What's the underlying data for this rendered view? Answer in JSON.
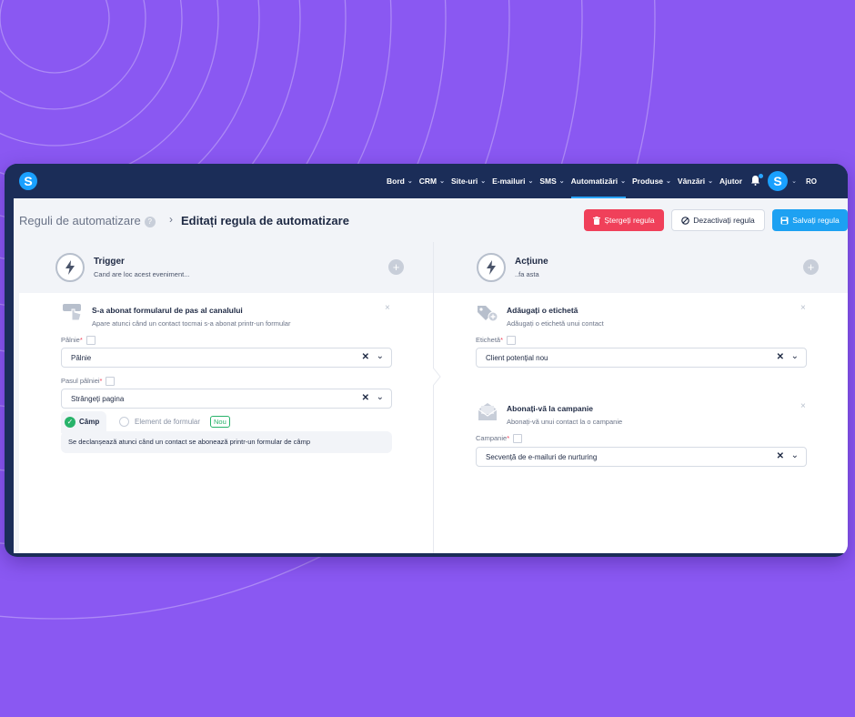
{
  "nav": {
    "items": [
      {
        "label": "Bord",
        "chevron": true,
        "active": false
      },
      {
        "label": "CRM",
        "chevron": true,
        "active": false
      },
      {
        "label": "Site-uri",
        "chevron": true,
        "active": false
      },
      {
        "label": "E-mailuri",
        "chevron": true,
        "active": false
      },
      {
        "label": "SMS",
        "chevron": true,
        "active": false
      },
      {
        "label": "Automatizări",
        "chevron": true,
        "active": true
      },
      {
        "label": "Produse",
        "chevron": true,
        "active": false
      },
      {
        "label": "Vânzări",
        "chevron": true,
        "active": false
      },
      {
        "label": "Ajutor",
        "chevron": false,
        "active": false
      }
    ],
    "logo_letter": "S",
    "avatar_letter": "S",
    "language": "RO"
  },
  "header": {
    "breadcrumb_root": "Reguli de automatizare",
    "help": "?",
    "breadcrumb_sep": "›",
    "breadcrumb_current": "Editați regula de automatizare",
    "delete_label": "Ștergeți regula",
    "deactivate_label": "Dezactivați regula",
    "save_label": "Salvați regula"
  },
  "trigger": {
    "title": "Trigger",
    "subtitle": "Cand are loc acest eveniment...",
    "card": {
      "title": "S-a abonat formularul de pas al canalului",
      "description": "Apare atunci când un contact tocmai s-a abonat printr-un formular",
      "funnel_label": "Pâlnie",
      "funnel_value": "Pâlnie",
      "step_label": "Pasul pâlniei",
      "step_value": "Strângeți pagina",
      "option_field": "Câmp",
      "option_form": "Element de formular",
      "new_badge": "Nou",
      "note": "Se declanșează atunci când un contact se abonează printr-un formular de câmp"
    }
  },
  "action": {
    "title": "Acțiune",
    "subtitle": "..fa asta",
    "tag_card": {
      "title": "Adăugați o etichetă",
      "description": "Adăugați o etichetă unui contact",
      "field_label": "Etichetă",
      "field_value": "Client potențial nou"
    },
    "campaign_card": {
      "title": "Abonați-vă la campanie",
      "description": "Abonați-vă unui contact la o campanie",
      "field_label": "Campanie",
      "field_value": "Secvență de e-mailuri de nurturing"
    }
  },
  "symbols": {
    "required": "*",
    "close": "×",
    "clear": "✕",
    "plus": "+",
    "chevron": "⌄",
    "check": "✓"
  },
  "colors": {
    "background": "#8a58f2",
    "topbar": "#1b2d58",
    "accent": "#1da1f2",
    "danger": "#f0405a",
    "success": "#27b36a"
  }
}
